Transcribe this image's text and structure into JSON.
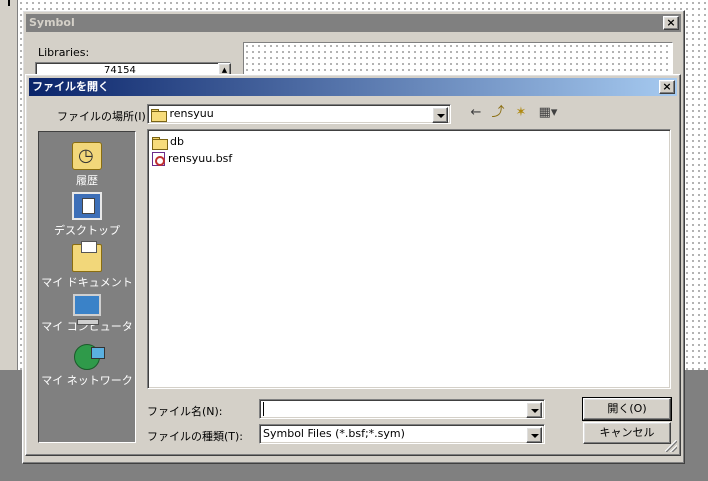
{
  "symbol_window": {
    "title": "Symbol",
    "close_glyph": "×",
    "libraries_label": "Libraries:",
    "library_selected": "74154",
    "library_scroll_glyph": "▲"
  },
  "dialog": {
    "title": "ファイルを開く",
    "close_glyph": "×",
    "look_in_label": "ファイルの場所(I):",
    "look_in_value": "rensyuu",
    "toolbar": {
      "back_glyph": "←",
      "up_glyph": "⤴",
      "new_folder_glyph": "✶",
      "view_glyph": "▦▾"
    },
    "places": [
      {
        "label": "履歴",
        "icon": "history-icon"
      },
      {
        "label": "デスクトップ",
        "icon": "desktop-icon"
      },
      {
        "label": "マイ ドキュメント",
        "icon": "my-documents-icon"
      },
      {
        "label": "マイ コンピュータ",
        "icon": "my-computer-icon"
      },
      {
        "label": "マイ ネットワーク",
        "icon": "my-network-icon"
      }
    ],
    "files": [
      {
        "name": "db",
        "type": "folder"
      },
      {
        "name": "rensyuu.bsf",
        "type": "file"
      }
    ],
    "filename_label": "ファイル名(N):",
    "filename_value": "",
    "filetype_label": "ファイルの種類(T):",
    "filetype_value": "Symbol Files (*.bsf;*.sym)",
    "open_button": "開く(O)",
    "cancel_button": "キャンセル"
  }
}
